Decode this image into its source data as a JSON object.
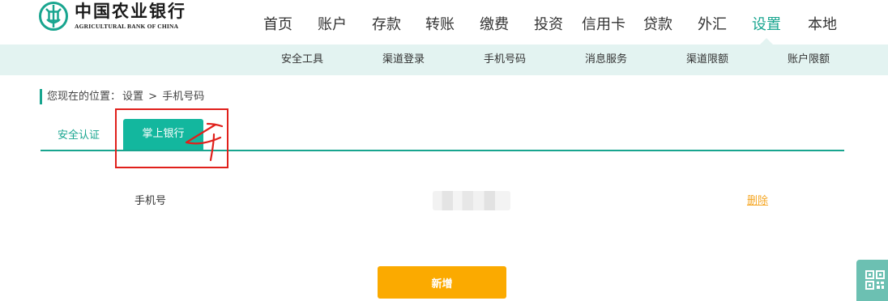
{
  "brand": {
    "name_cn": "中国农业银行",
    "name_en": "AGRICULTURAL BANK OF CHINA",
    "logo_icon": "abc-coin-logo-icon",
    "color": "#18a58f"
  },
  "main_nav": {
    "items": [
      "首页",
      "账户",
      "存款",
      "转账",
      "缴费",
      "投资",
      "信用卡",
      "贷款",
      "外汇",
      "设置",
      "本地"
    ],
    "active": "设置"
  },
  "sub_nav": {
    "items": [
      "安全工具",
      "渠道登录",
      "手机号码",
      "消息服务",
      "渠道限额",
      "账户限额"
    ]
  },
  "breadcrumb": {
    "prefix": "您现在的位置：",
    "section": "设置",
    "separator": ">",
    "current": "手机号码"
  },
  "tabs": {
    "items": [
      "安全认证",
      "掌上银行"
    ],
    "active": "掌上银行"
  },
  "phone_row": {
    "label": "手机号",
    "value": "",
    "action": "删除"
  },
  "add_button": "新增",
  "colors": {
    "accent": "#18a58f",
    "sub_nav_bg": "#e3f3f1",
    "active_tab_bg": "#13b79e",
    "button": "#fbaa00",
    "link": "#f5a623",
    "annotation": "#e0201b"
  },
  "icons": {
    "qr": "qr-code-icon"
  }
}
